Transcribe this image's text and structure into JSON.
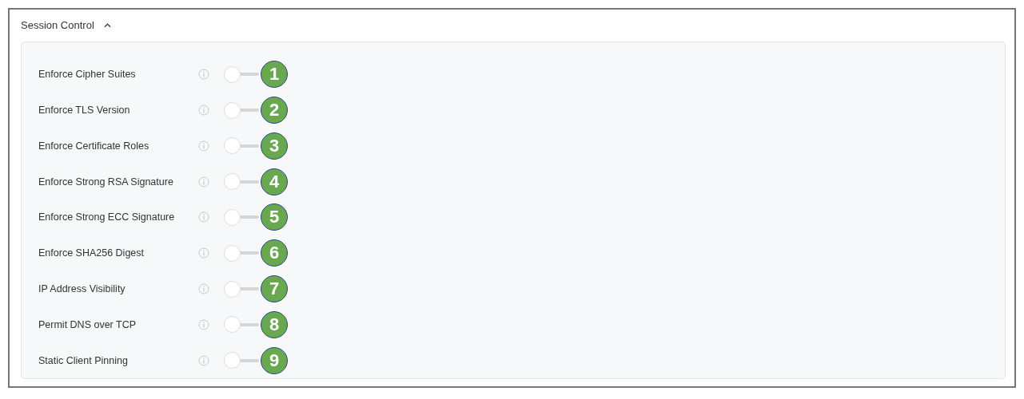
{
  "section": {
    "title": "Session Control",
    "expanded": true
  },
  "settings": [
    {
      "label": "Enforce Cipher Suites",
      "on": false,
      "badge": "1"
    },
    {
      "label": "Enforce TLS Version",
      "on": false,
      "badge": "2"
    },
    {
      "label": "Enforce Certificate Roles",
      "on": false,
      "badge": "3"
    },
    {
      "label": "Enforce Strong RSA Signature",
      "on": false,
      "badge": "4"
    },
    {
      "label": "Enforce Strong ECC Signature",
      "on": false,
      "badge": "5"
    },
    {
      "label": "Enforce SHA256 Digest",
      "on": false,
      "badge": "6"
    },
    {
      "label": "IP Address Visibility",
      "on": false,
      "badge": "7"
    },
    {
      "label": "Permit DNS over TCP",
      "on": false,
      "badge": "8"
    },
    {
      "label": "Static Client Pinning",
      "on": false,
      "badge": "9"
    }
  ]
}
